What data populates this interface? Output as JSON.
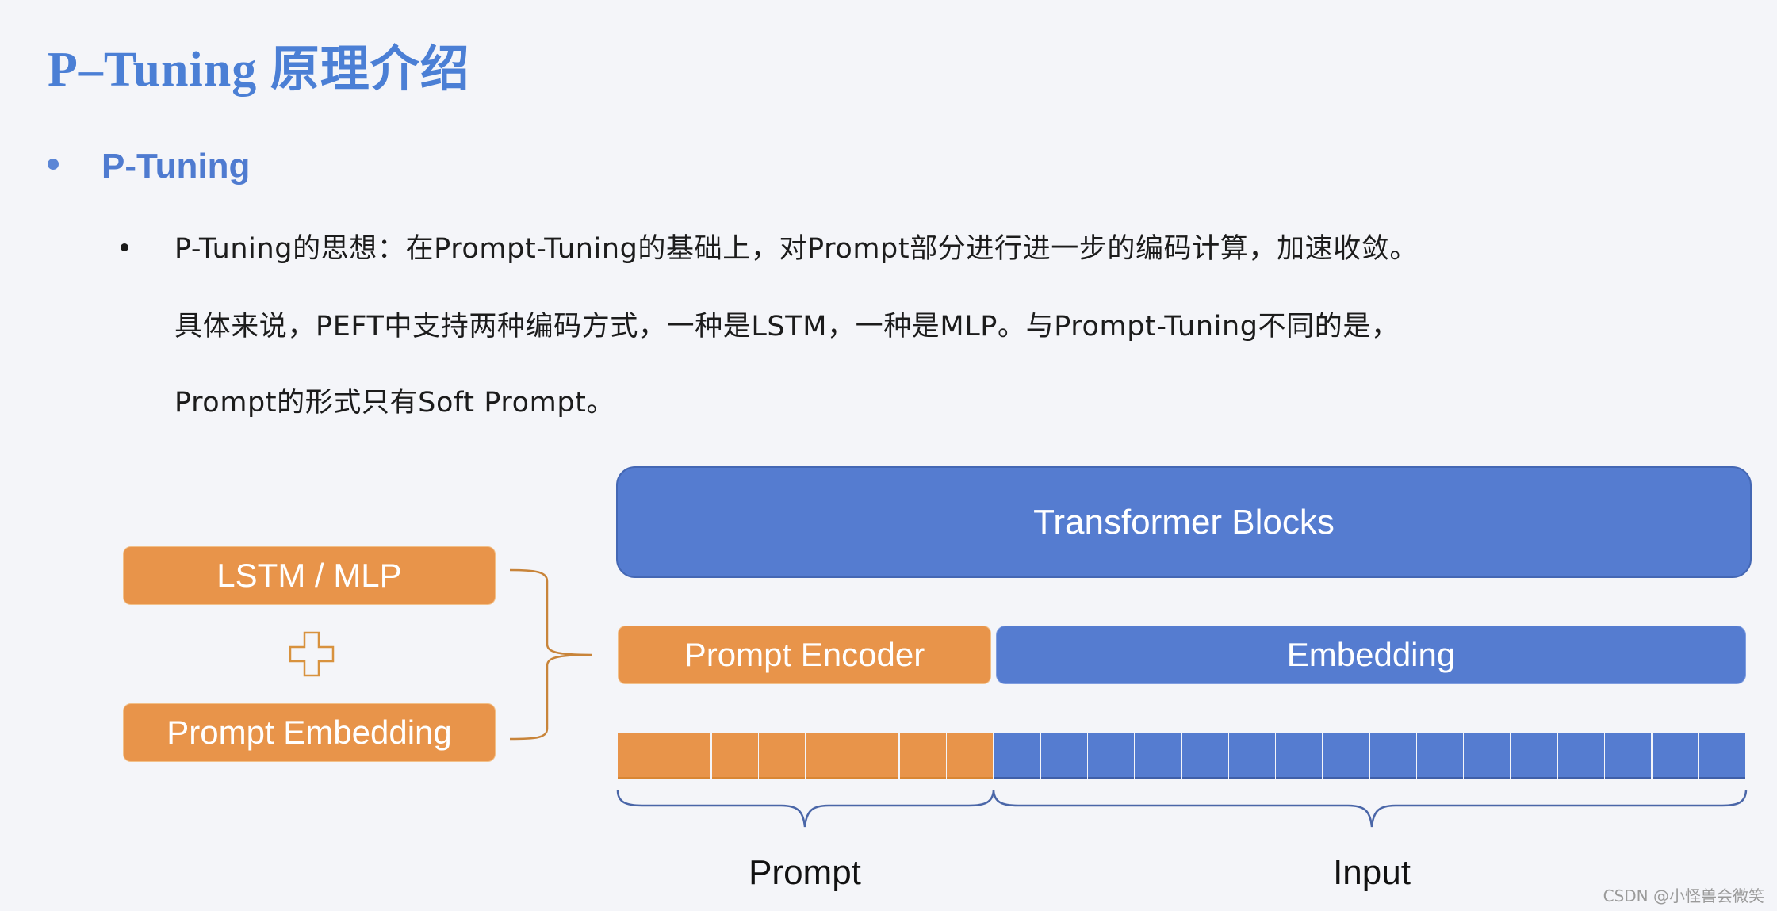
{
  "slide": {
    "title": "P–Tuning 原理介绍",
    "subheading": "P-Tuning",
    "body_lines": [
      "P-Tuning的思想：在Prompt-Tuning的基础上，对Prompt部分进行进一步的编码计算，加速收敛。",
      "具体来说，PEFT中支持两种编码方式，一种是LSTM，一种是MLP。与Prompt-Tuning不同的是，",
      "Prompt的形式只有Soft Prompt。"
    ]
  },
  "diagram": {
    "transformer_label": "Transformer Blocks",
    "encoder_parts": {
      "top": "LSTM / MLP",
      "plus_icon": "plus-icon",
      "bottom": "Prompt Embedding"
    },
    "prompt_encoder_label": "Prompt Encoder",
    "embedding_label": "Embedding",
    "prompt_token_count": 8,
    "input_token_count": 16,
    "prompt_brace_label": "Prompt",
    "input_brace_label": "Input",
    "colors": {
      "orange": "#e8944a",
      "blue": "#557cd0",
      "bracket": "#c8843a",
      "brace_blue": "#4a66a8"
    }
  },
  "watermark": "CSDN @小怪兽会微笑"
}
